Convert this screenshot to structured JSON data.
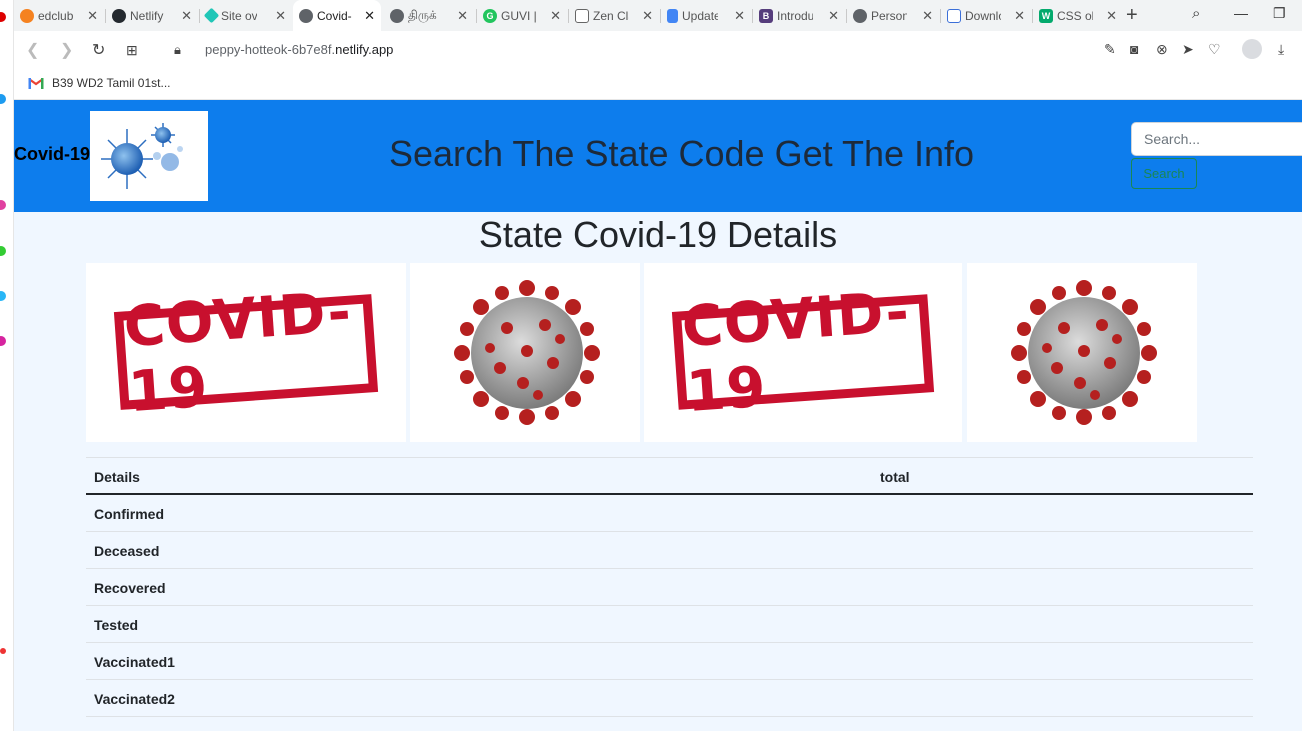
{
  "browser": {
    "tabs": [
      {
        "label": "edclub",
        "icon": "edclub-icon",
        "color": "#f58220"
      },
      {
        "label": "Netlify",
        "icon": "github-icon",
        "color": "#24292f"
      },
      {
        "label": "Site ov",
        "icon": "netlify-icon",
        "color": "#20c6b7"
      },
      {
        "label": "Covid-",
        "icon": "globe-icon",
        "color": "#5f6368",
        "active": true
      },
      {
        "label": "திருக்",
        "icon": "globe-icon",
        "color": "#5f6368"
      },
      {
        "label": "GUVI |",
        "icon": "guvi-icon",
        "color": "#22c55e"
      },
      {
        "label": "Zen Cla",
        "icon": "zen-icon",
        "color": "#666666"
      },
      {
        "label": "Update",
        "icon": "docs-icon",
        "color": "#4285f4"
      },
      {
        "label": "Introdu",
        "icon": "bootstrap-icon",
        "color": "#563d7c"
      },
      {
        "label": "Persona",
        "icon": "globe-icon",
        "color": "#5f6368"
      },
      {
        "label": "Downlo",
        "icon": "flag-icon",
        "color": "#3b6fd8"
      },
      {
        "label": "CSS ob",
        "icon": "w3schools-icon",
        "color": "#04aa6d"
      }
    ],
    "url_prefix": "peppy-hotteok-6b7e8f.",
    "url_host": "netlify.app",
    "bookmark": "B39 WD2 Tamil 01st..."
  },
  "header": {
    "brand": "Covid-19",
    "title": "Search The State Code Get The Info",
    "search_placeholder": "Search...",
    "search_button": "Search"
  },
  "main": {
    "title": "State Covid-19 Details",
    "stamp_text": "COVID-19"
  },
  "table": {
    "headers": [
      "Details",
      "total"
    ],
    "rows": [
      "Confirmed",
      "Deceased",
      "Recovered",
      "Tested",
      "Vaccinated1",
      "Vaccinated2"
    ]
  },
  "colors": {
    "header_bg": "#0d7ded",
    "page_bg": "#f0f7ff",
    "stamp_red": "#c8102e",
    "button_green": "#198754"
  }
}
